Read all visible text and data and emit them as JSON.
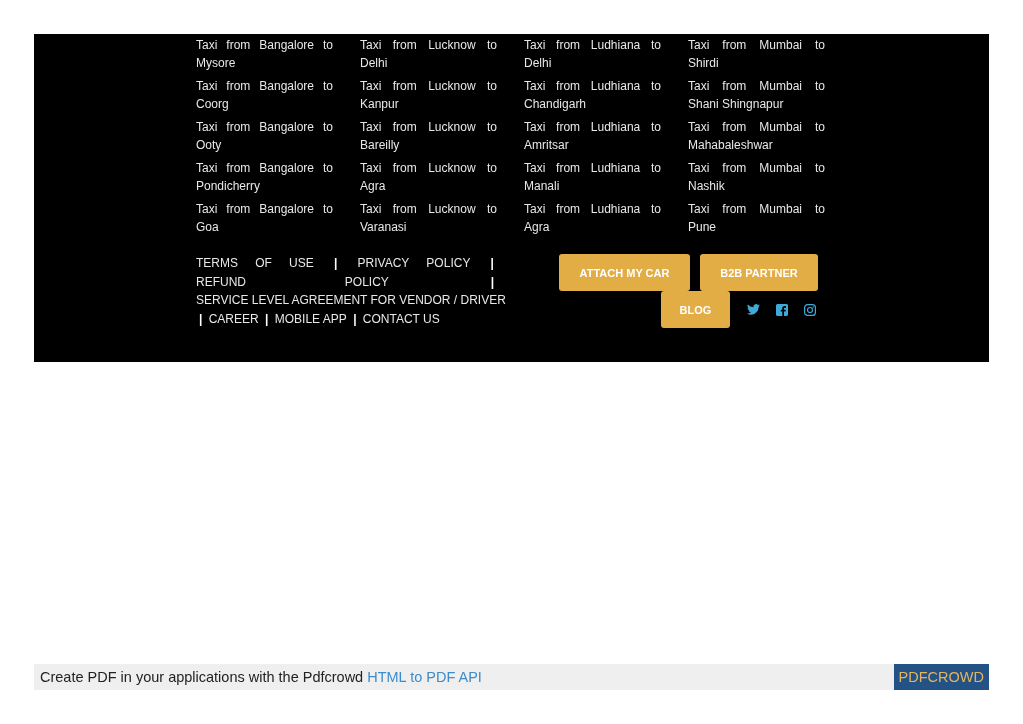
{
  "route_columns": [
    {
      "links": [
        "Taxi from Bangalore to Mysore",
        "Taxi from Bangalore to Coorg",
        "Taxi from Bangalore to Ooty",
        "Taxi from Bangalore to Pondicherry",
        "Taxi from Bangalore to Goa"
      ]
    },
    {
      "links": [
        "Taxi from Lucknow to Delhi",
        "Taxi from Lucknow to Kanpur",
        "Taxi from Lucknow to Bareilly",
        "Taxi from Lucknow to Agra",
        "Taxi from Lucknow to Varanasi"
      ]
    },
    {
      "links": [
        "Taxi from Ludhiana to Delhi",
        "Taxi from Ludhiana to Chandigarh",
        "Taxi from Ludhiana to Amritsar",
        "Taxi from Ludhiana to Manali",
        "Taxi from Ludhiana to Agra"
      ]
    },
    {
      "links": [
        "Taxi from Mumbai to Shirdi",
        "Taxi from Mumbai to Shani Shingnapur",
        "Taxi from Mumbai to Mahabaleshwar",
        "Taxi from Mumbai to Nashik",
        "Taxi from Mumbai to Pune"
      ]
    }
  ],
  "policy_links": [
    {
      "label": "TERMS OF USE",
      "separator": "|"
    },
    {
      "label": "PRIVACY POLICY",
      "separator": "|"
    },
    {
      "label": "REFUND POLICY",
      "separator": "|"
    },
    {
      "label": "SERVICE LEVEL AGREEMENT FOR VENDOR / DRIVER",
      "separator": "|"
    },
    {
      "label": "CAREER",
      "separator": "|"
    },
    {
      "label": "MOBILE APP",
      "separator": "|"
    },
    {
      "label": "CONTACT US"
    }
  ],
  "buttons": [
    "ATTACH MY CAR",
    "B2B PARTNER",
    "BLOG"
  ],
  "social": [
    {
      "kind": "twitter"
    },
    {
      "kind": "facebook"
    },
    {
      "kind": "instagram"
    }
  ],
  "pdf_bar": {
    "text": "Create PDF in your applications with the Pdfcrowd",
    "link": "HTML to PDF API",
    "badge": "PDFCROWD"
  }
}
